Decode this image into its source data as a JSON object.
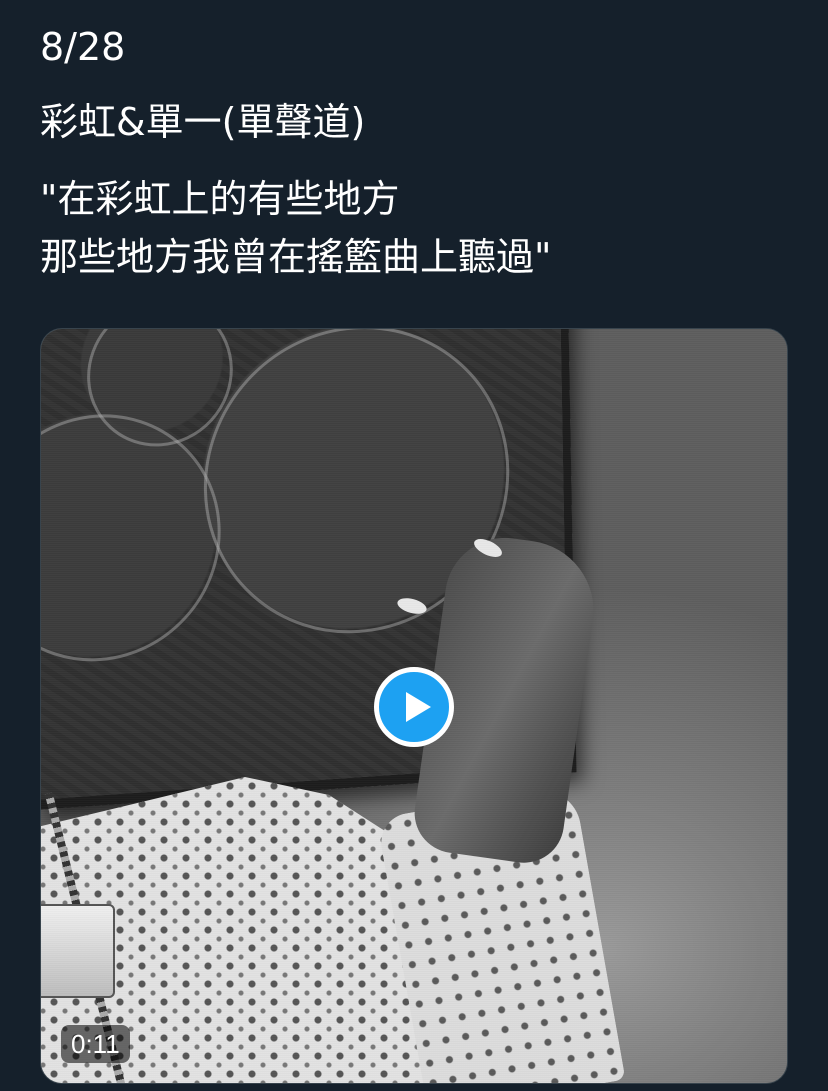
{
  "tweet": {
    "date": "8/28",
    "title": "彩虹&單一(單聲道)",
    "lyrics": [
      "\"在彩虹上的有些地方",
      "那些地方我曾在搖籃曲上聽過\""
    ]
  },
  "media": {
    "type": "video",
    "duration": "0:11",
    "play_icon": "play-icon",
    "accent_color": "#1da1f2"
  },
  "theme": {
    "background": "#15202b",
    "text_color": "#ffffff"
  }
}
